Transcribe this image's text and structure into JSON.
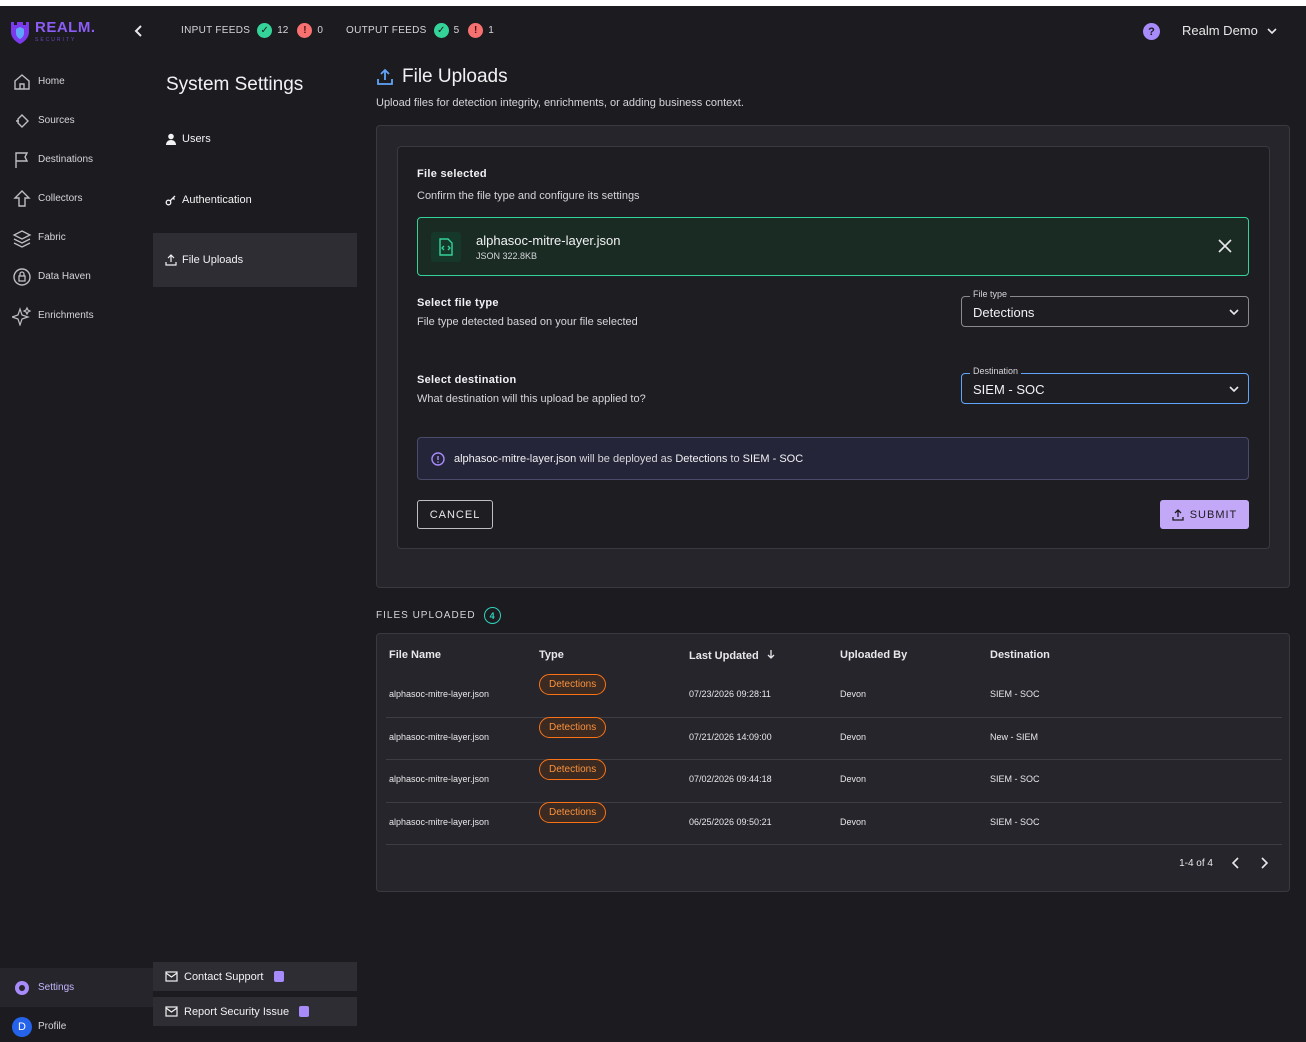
{
  "brand": {
    "name": "REALM.",
    "sub": "SECURITY"
  },
  "topbar": {
    "input_feeds": {
      "label": "INPUT FEEDS",
      "ok": "12",
      "err": "0"
    },
    "output_feeds": {
      "label": "OUTPUT FEEDS",
      "ok": "5",
      "err": "1"
    },
    "help": "?",
    "account": "Realm Demo"
  },
  "nav": {
    "items": [
      {
        "label": "Home",
        "icon": "home-icon"
      },
      {
        "label": "Sources",
        "icon": "sources-icon"
      },
      {
        "label": "Destinations",
        "icon": "flag-icon"
      },
      {
        "label": "Collectors",
        "icon": "collector-icon"
      },
      {
        "label": "Fabric",
        "icon": "layers-icon"
      },
      {
        "label": "Data Haven",
        "icon": "vault-icon"
      },
      {
        "label": "Enrichments",
        "icon": "sparkle-icon"
      }
    ],
    "settings": "Settings",
    "profile": "Profile",
    "profile_initial": "D"
  },
  "settings": {
    "title": "System Settings",
    "items": [
      "Users",
      "Authentication",
      "File Uploads"
    ],
    "contact_support": "Contact Support",
    "report_security": "Report Security Issue"
  },
  "page": {
    "title": "File Uploads",
    "subtitle": "Upload files for detection integrity, enrichments, or adding business context."
  },
  "upload": {
    "heading": "File selected",
    "heading_sub": "Confirm the file type and configure its settings",
    "file_name": "alphasoc-mitre-layer.json",
    "file_meta": "JSON 322.8KB",
    "type_heading": "Select file type",
    "type_sub": "File type detected based on your file selected",
    "type_legend": "File type",
    "type_value": "Detections",
    "dest_heading": "Select destination",
    "dest_sub": "What destination will this upload be applied to?",
    "dest_legend": "Destination",
    "dest_value": "SIEM - SOC",
    "info": {
      "file": "alphasoc-mitre-layer.json",
      "mid": "will be deployed as",
      "type": "Detections",
      "to": "to",
      "dest": "SIEM - SOC"
    },
    "cancel": "CANCEL",
    "submit": "SUBMIT"
  },
  "files": {
    "label": "FILES UPLOADED",
    "count": "4",
    "columns": [
      "File Name",
      "Type",
      "Last Updated",
      "Uploaded By",
      "Destination"
    ],
    "rows": [
      {
        "name": "alphasoc-mitre-layer.json",
        "type": "Detections",
        "updated": "07/23/2026 09:28:11",
        "by": "Devon",
        "dest": "SIEM - SOC"
      },
      {
        "name": "alphasoc-mitre-layer.json",
        "type": "Detections",
        "updated": "07/21/2026 14:09:00",
        "by": "Devon",
        "dest": "New - SIEM"
      },
      {
        "name": "alphasoc-mitre-layer.json",
        "type": "Detections",
        "updated": "07/02/2026 09:44:18",
        "by": "Devon",
        "dest": "SIEM - SOC"
      },
      {
        "name": "alphasoc-mitre-layer.json",
        "type": "Detections",
        "updated": "06/25/2026 09:50:21",
        "by": "Devon",
        "dest": "SIEM - SOC"
      }
    ],
    "pagination": "1-4 of 4"
  },
  "colors": {
    "accent": "#a78bfa",
    "success": "#34d399",
    "error": "#f87171",
    "badge": "#f97316"
  }
}
